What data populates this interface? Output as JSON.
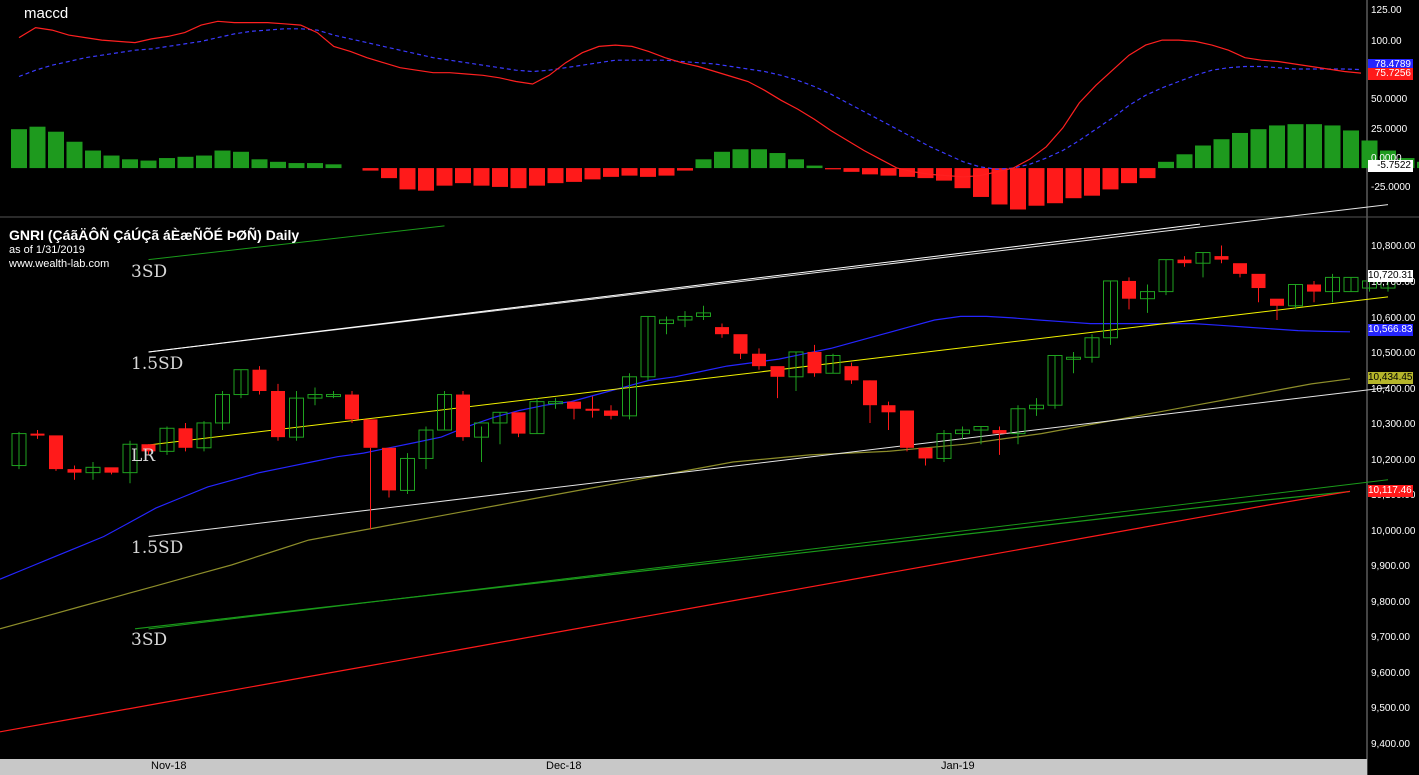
{
  "indicator_label": "maccd",
  "price_panel": {
    "title": "GNRI (ÇáãÄÔÑ ÇáÚÇã áÈæÑÕÉ ÞØÑ) Daily",
    "as_of": "as of 1/31/2019",
    "website": "www.wealth-lab.com"
  },
  "band_labels": {
    "upper_3sd": "3SD",
    "upper_15sd": "1.5SD",
    "lr": "LR",
    "lower_15sd": "1.5SD",
    "lower_3sd": "3SD"
  },
  "colors": {
    "background": "#000000",
    "candle_up": "#1fa21f",
    "candle_down": "#ff1a1a",
    "macd_line": "#ff2020",
    "signal_line": "#3a3aff",
    "hist_up": "#1e9a1e",
    "hist_down": "#ff1a1a",
    "lr_line": "#f2f200",
    "sd15_lines": "#e6e6e6",
    "sd3_line": "#e6e6e6",
    "ma_blue": "#2525ff",
    "ma_olive": "#8d8d2a",
    "ma_green": "#1a9a1a",
    "ma_red": "#ff1a1a"
  },
  "chart_data": [
    {
      "type": "line",
      "name": "macd panel",
      "title": "maccd",
      "ylim": [
        -35,
        130
      ],
      "y_ticks": [
        "125.00",
        "100.00",
        "50.0000",
        "25.0000",
        "0.0000",
        "-25.0000"
      ],
      "current_values": {
        "macd": "75.7256",
        "signal": "78.4789",
        "histogram": "-5.7522"
      },
      "series": [
        {
          "values": [
            104,
            112,
            110,
            106,
            104,
            102,
            101,
            100,
            103,
            105,
            108,
            114,
            117,
            116,
            116,
            116,
            115,
            114,
            108,
            97,
            93,
            88,
            84,
            80,
            78,
            76,
            76,
            75,
            74,
            72,
            69,
            67,
            74,
            84,
            92,
            97,
            98,
            97,
            93,
            88,
            84,
            81,
            77,
            73,
            69,
            62,
            54,
            47,
            39,
            30,
            22,
            14,
            7,
            0,
            -3,
            -5,
            -6,
            -7,
            -6,
            -3,
            0,
            7,
            17,
            32,
            52,
            66,
            78,
            90,
            98,
            102,
            102,
            101,
            98,
            94,
            88,
            86,
            85,
            83,
            81,
            79,
            77,
            75.7
          ]
        },
        {
          "values": [
            73,
            78,
            82,
            85,
            88,
            90,
            92,
            94,
            95,
            97,
            99,
            101,
            104,
            107,
            109,
            110,
            111,
            111,
            110,
            106,
            103,
            100,
            97,
            94,
            91,
            88,
            86,
            84,
            82,
            80,
            78,
            77,
            78,
            80,
            82,
            84,
            86,
            86,
            86,
            86,
            85,
            84,
            83,
            81,
            79,
            77,
            74,
            70,
            65,
            59,
            52,
            45,
            38,
            31,
            24,
            17,
            11,
            5,
            1,
            -1,
            0,
            3,
            8,
            14,
            22,
            31,
            40,
            50,
            58,
            64,
            69,
            74,
            78,
            80,
            81,
            81,
            80,
            79,
            79,
            79,
            79,
            78.5
          ]
        },
        {
          "values": [
            31,
            33,
            29,
            21,
            14,
            10,
            7,
            6,
            8,
            9,
            10,
            14,
            13,
            7,
            5,
            4,
            4,
            3,
            null,
            -2,
            -8,
            -17,
            -18,
            -14,
            -12,
            -14,
            -15,
            -16,
            -14,
            -12,
            -11,
            -9,
            -7,
            -6,
            -7,
            -6,
            -2,
            7,
            13,
            15,
            15,
            12,
            7,
            2,
            -1,
            -3,
            -5,
            -6,
            -7,
            -8,
            -10,
            -16,
            -23,
            -29,
            -33,
            -30,
            -28,
            -24,
            -22,
            -17,
            -12,
            -8,
            5,
            11,
            18,
            23,
            28,
            31,
            34,
            35,
            35,
            34,
            30,
            22,
            14,
            8,
            5,
            null,
            -3,
            -4,
            -4,
            -5.7
          ]
        }
      ]
    },
    {
      "type": "line",
      "name": "price panel",
      "title": "GNRI (ÇáãÄÔÑ ÇáÚÇã áÈæÑÕÉ ÞØÑ) Daily",
      "x_tick_labels": [
        "Nov-18",
        "Dec-18",
        "Jan-19"
      ],
      "y_ticks": [
        "10,800.00",
        "10,700.00",
        "10,600.00",
        "10,500.00",
        "10,400.00",
        "10,300.00",
        "10,200.00",
        "10,100.00",
        "10,000.00",
        "9,900.00",
        "9,800.00",
        "9,700.00",
        "9,600.00",
        "9,500.00",
        "9,400.00"
      ],
      "ylim": [
        9370,
        10860
      ],
      "current_values": {
        "close": "10,720.31",
        "ma_blue": "10,566.83",
        "ma_olive": "10,434.45",
        "ma_red": "10,117.46"
      },
      "candles": [
        [
          10190,
          10285,
          10180,
          10280
        ],
        [
          10280,
          10290,
          10265,
          10275
        ],
        [
          10275,
          10270,
          10175,
          10180
        ],
        [
          10180,
          10190,
          10150,
          10170
        ],
        [
          10170,
          10200,
          10150,
          10185
        ],
        [
          10185,
          10175,
          10165,
          10170
        ],
        [
          10170,
          10260,
          10140,
          10250
        ],
        [
          10250,
          10250,
          10220,
          10230
        ],
        [
          10230,
          10300,
          10220,
          10295
        ],
        [
          10295,
          10310,
          10230,
          10240
        ],
        [
          10240,
          10315,
          10230,
          10310
        ],
        [
          10310,
          10400,
          10290,
          10390
        ],
        [
          10390,
          10460,
          10380,
          10460
        ],
        [
          10460,
          10470,
          10390,
          10400
        ],
        [
          10400,
          10420,
          10260,
          10270
        ],
        [
          10270,
          10400,
          10260,
          10380
        ],
        [
          10380,
          10410,
          10360,
          10390
        ],
        [
          10390,
          10400,
          10380,
          10390
        ],
        [
          10390,
          10400,
          10310,
          10320
        ],
        [
          10320,
          10240,
          10010,
          10240
        ],
        [
          10240,
          10240,
          10100,
          10120
        ],
        [
          10120,
          10225,
          10110,
          10210
        ],
        [
          10210,
          10300,
          10180,
          10290
        ],
        [
          10290,
          10400,
          10290,
          10390
        ],
        [
          10390,
          10400,
          10260,
          10270
        ],
        [
          10270,
          10300,
          10200,
          10310
        ],
        [
          10310,
          10340,
          10250,
          10340
        ],
        [
          10340,
          10330,
          10270,
          10280
        ],
        [
          10280,
          10380,
          10280,
          10370
        ],
        [
          10370,
          10380,
          10350,
          10370
        ],
        [
          10370,
          10360,
          10320,
          10350
        ],
        [
          10350,
          10385,
          10325,
          10345
        ],
        [
          10345,
          10360,
          10320,
          10330
        ],
        [
          10330,
          10450,
          10320,
          10440
        ],
        [
          10440,
          10610,
          10430,
          10610
        ],
        [
          10590,
          10610,
          10560,
          10600
        ],
        [
          10600,
          10625,
          10580,
          10610
        ],
        [
          10610,
          10640,
          10600,
          10620
        ],
        [
          10580,
          10590,
          10550,
          10560
        ],
        [
          10560,
          10545,
          10490,
          10505
        ],
        [
          10505,
          10520,
          10460,
          10470
        ],
        [
          10470,
          10450,
          10380,
          10440
        ],
        [
          10440,
          10510,
          10400,
          10510
        ],
        [
          10510,
          10530,
          10440,
          10450
        ],
        [
          10450,
          10505,
          10450,
          10500
        ],
        [
          10470,
          10480,
          10420,
          10430
        ],
        [
          10430,
          10430,
          10310,
          10360
        ],
        [
          10360,
          10370,
          10290,
          10340
        ],
        [
          10345,
          10345,
          10230,
          10240
        ],
        [
          10240,
          10240,
          10190,
          10210
        ],
        [
          10210,
          10290,
          10200,
          10280
        ],
        [
          10280,
          10300,
          10265,
          10290
        ],
        [
          10290,
          10300,
          10250,
          10300
        ],
        [
          10290,
          10300,
          10220,
          10280
        ],
        [
          10280,
          10360,
          10250,
          10350
        ],
        [
          10350,
          10380,
          10330,
          10360
        ],
        [
          10360,
          10500,
          10350,
          10500
        ],
        [
          10490,
          10510,
          10450,
          10495
        ],
        [
          10495,
          10560,
          10480,
          10550
        ],
        [
          10550,
          10710,
          10530,
          10710
        ],
        [
          10710,
          10720,
          10630,
          10660
        ],
        [
          10660,
          10700,
          10620,
          10680
        ],
        [
          10680,
          10770,
          10670,
          10770
        ],
        [
          10770,
          10780,
          10750,
          10760
        ],
        [
          10760,
          10790,
          10720,
          10790
        ],
        [
          10780,
          10810,
          10760,
          10770
        ],
        [
          10760,
          10750,
          10720,
          10730
        ],
        [
          10730,
          10720,
          10650,
          10690
        ],
        [
          10660,
          10650,
          10600,
          10640
        ],
        [
          10640,
          10700,
          10630,
          10700
        ],
        [
          10700,
          10710,
          10650,
          10680
        ],
        [
          10680,
          10730,
          10650,
          10720
        ],
        [
          10680,
          10720,
          10680,
          10720
        ],
        [
          10690,
          10720,
          10680,
          10710
        ],
        [
          10690,
          10740,
          10680,
          10720
        ]
      ],
      "lines": [
        {
          "role": "lr",
          "start": 10248,
          "end": 10665,
          "x_from_bar": 7,
          "x_to_bar": 74
        },
        {
          "role": "upper_15sd",
          "start": 10510,
          "end": 10925,
          "x_from_bar": 7,
          "x_to_bar": 74
        },
        {
          "role": "lower_15sd",
          "start": 9990,
          "end": 10410,
          "x_from_bar": 7,
          "x_to_bar": 74
        },
        {
          "role": "upper_3sd",
          "start": 10770,
          "end": 10865,
          "x_from_bar": 7,
          "x_to_bar": 23
        },
        {
          "role": "lower_3sd",
          "start": 9730,
          "end": 10150,
          "x_from_bar": 7,
          "x_to_bar": 74
        }
      ],
      "moving_averages": [
        {
          "role": "ma_blue",
          "values": [
            9870,
            9900,
            9930,
            9960,
            9990,
            10030,
            10070,
            10100,
            10130,
            10150,
            10170,
            10185,
            10200,
            10215,
            10225,
            10240,
            10255,
            10270,
            10300,
            10325,
            10345,
            10360,
            10370,
            10390,
            10410,
            10430,
            10440,
            10455,
            10470,
            10480,
            10490,
            10505,
            10520,
            10540,
            10560,
            10580,
            10600,
            10610,
            10610,
            10606,
            10600,
            10595,
            10590,
            10590,
            10590,
            10590,
            10590,
            10585,
            10580,
            10575,
            10570,
            10568,
            10566.83
          ]
        },
        {
          "role": "ma_olive",
          "values": [
            9730,
            9760,
            9790,
            9820,
            9850,
            9880,
            9910,
            9945,
            9980,
            10000,
            10020,
            10040,
            10060,
            10080,
            10100,
            10120,
            10140,
            10160,
            10180,
            10200,
            10210,
            10220,
            10225,
            10230,
            10240,
            10250,
            10265,
            10280,
            10300,
            10320,
            10340,
            10360,
            10380,
            10400,
            10420,
            10434.45
          ]
        },
        {
          "role": "ma_green",
          "values": [
            9730,
            9760,
            9790,
            9820,
            9850,
            9880,
            9910,
            9940,
            9970,
            10000,
            10030,
            10060,
            10090,
            10117
          ]
        },
        {
          "role": "ma_red",
          "values": [
            9440,
            9480,
            9520,
            9560,
            9600,
            9640,
            9680,
            9720,
            9760,
            9800,
            9840,
            9880,
            9920,
            9960,
            10000,
            10040,
            10080,
            10117.46
          ]
        }
      ]
    }
  ]
}
